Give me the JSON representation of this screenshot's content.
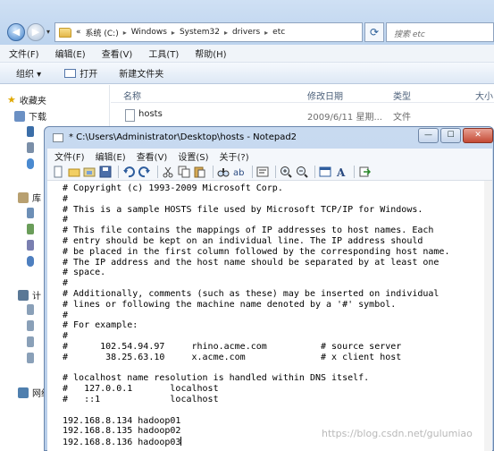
{
  "explorer": {
    "breadcrumb": [
      "«",
      "系统 (C:)",
      "Windows",
      "System32",
      "drivers",
      "etc"
    ],
    "search_placeholder": "搜索 etc",
    "menu": [
      "文件(F)",
      "编辑(E)",
      "查看(V)",
      "工具(T)",
      "帮助(H)"
    ],
    "toolbar": {
      "organize": "组织 ▾",
      "open": "打开",
      "new_folder": "新建文件夹"
    },
    "nav": {
      "favorites": "收藏夹",
      "downloads": "下载",
      "libraries": "库",
      "computer": "计",
      "network": "网络"
    },
    "columns": {
      "name": "名称",
      "modified": "修改日期",
      "type": "类型",
      "size": "大小"
    },
    "file": {
      "name": "hosts",
      "modified": "2009/6/11 星期...",
      "type": "文件"
    },
    "colors": {
      "addr_bar": "#cfe0f4",
      "accent": "#3c6aa3"
    }
  },
  "notepad": {
    "title": "* C:\\Users\\Administrator\\Desktop\\hosts - Notepad2",
    "menu": [
      "文件(F)",
      "编辑(E)",
      "查看(V)",
      "设置(S)",
      "关于(?)"
    ],
    "caption": {
      "minimize": "—",
      "maximize": "☐",
      "close": "✕"
    },
    "toolbar_icons": [
      "new-icon",
      "open-icon",
      "browse-icon",
      "save-icon",
      "undo-icon",
      "redo-icon",
      "cut-icon",
      "copy-icon",
      "paste-icon",
      "find-icon",
      "replace-icon",
      "wordwrap-icon",
      "zoom-in-icon",
      "zoom-out-icon",
      "schemes-icon",
      "font-icon",
      "exit-icon"
    ],
    "lines": [
      "# Copyright (c) 1993-2009 Microsoft Corp.",
      "#",
      "# This is a sample HOSTS file used by Microsoft TCP/IP for Windows.",
      "#",
      "# This file contains the mappings of IP addresses to host names. Each",
      "# entry should be kept on an individual line. The IP address should",
      "# be placed in the first column followed by the corresponding host name.",
      "# The IP address and the host name should be separated by at least one",
      "# space.",
      "#",
      "# Additionally, comments (such as these) may be inserted on individual",
      "# lines or following the machine name denoted by a '#' symbol.",
      "#",
      "# For example:",
      "#",
      "#      102.54.94.97     rhino.acme.com          # source server",
      "#       38.25.63.10     x.acme.com              # x client host",
      "",
      "# localhost name resolution is handled within DNS itself.",
      "#   127.0.0.1       localhost",
      "#   ::1             localhost",
      "",
      "192.168.8.134 hadoop01",
      "192.168.8.135 hadoop02",
      "192.168.8.136 hadoop03"
    ]
  },
  "watermark": "https://blog.csdn.net/gulumiao"
}
